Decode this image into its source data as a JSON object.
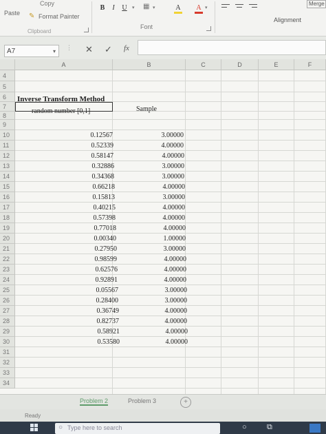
{
  "ribbon": {
    "paste_label": "Paste",
    "copy_label": "Copy",
    "format_painter_label": "Format Painter",
    "clipboard_group": "Clipboard",
    "font_group": "Font",
    "alignment_group": "Alignment",
    "merge_label": "Merge",
    "bold": "B",
    "italic": "I",
    "underline": "U",
    "fill_icon": "A",
    "font_color_icon": "A",
    "font_color": "#d73a2c",
    "fill_color": "#f1d233"
  },
  "formula_bar": {
    "name_box": "A7",
    "cancel_icon": "✕",
    "enter_icon": "✓",
    "fx_icon": "fx",
    "formula": ""
  },
  "columns": [
    "A",
    "B",
    "C",
    "D",
    "E",
    "F"
  ],
  "rows": [
    "4",
    "5",
    "6",
    "7",
    "8",
    "9",
    "10",
    "11",
    "12",
    "13",
    "14",
    "15",
    "16",
    "17",
    "18",
    "19",
    "20",
    "21",
    "22",
    "23",
    "24",
    "25",
    "26",
    "27",
    "28",
    "29",
    "30",
    "31",
    "32",
    "33",
    "34"
  ],
  "sheet": {
    "title": "Inverse Transform Method",
    "header_a": "random number [0,1]",
    "header_b": "Sample",
    "random_numbers": [
      "0.12567",
      "0.52339",
      "0.58147",
      "0.32886",
      "0.34368",
      "0.66218",
      "0.15813",
      "0.40215",
      "0.57398",
      "0.77018",
      "0.00340",
      "0.27950",
      "0.98599",
      "0.62576",
      "0.92891",
      "0.05567",
      "0.28400",
      "0.36749",
      "0.82737",
      "0.58921",
      "0.53580"
    ],
    "samples": [
      "3.00000",
      "4.00000",
      "4.00000",
      "3.00000",
      "3.00000",
      "4.00000",
      "3.00000",
      "4.00000",
      "4.00000",
      "4.00000",
      "1.00000",
      "3.00000",
      "4.00000",
      "4.00000",
      "4.00000",
      "3.00000",
      "3.00000",
      "4.00000",
      "4.00000",
      "4.00000",
      "4.00000"
    ]
  },
  "tabs": [
    "Problem 2",
    "Problem 3"
  ],
  "add_sheet_icon": "+",
  "status": "Ready",
  "taskbar": {
    "search_placeholder": "Type here to search"
  }
}
